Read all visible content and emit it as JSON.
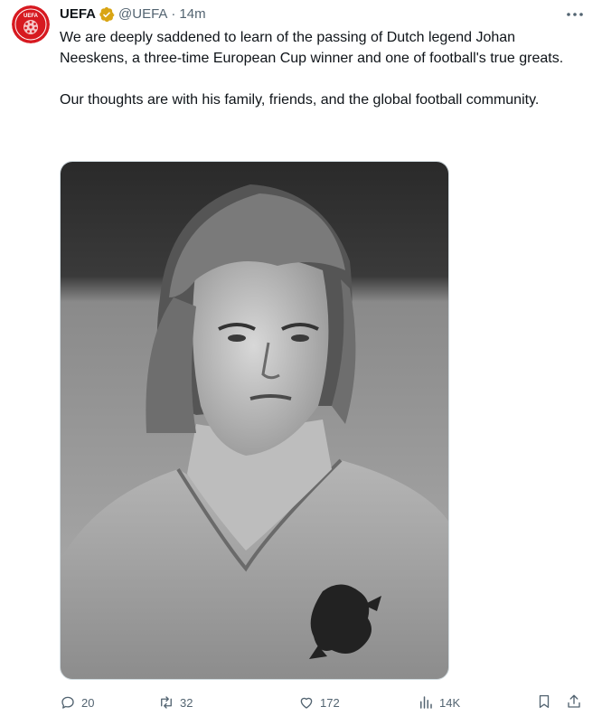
{
  "author": {
    "name": "UEFA",
    "handle": "@UEFA",
    "separator": "·",
    "timestamp": "14m",
    "avatar_text": "UEFA",
    "verified_badge_color": "#d9a514",
    "avatar_color": "#d71920"
  },
  "tweet": {
    "paragraph_1": "We are deeply saddened to learn of the passing of Dutch legend Johan Neeskens, a three-time European Cup winner and one of football's true greats.",
    "paragraph_2": "Our thoughts are with his family, friends, and the global football community."
  },
  "media": {
    "type": "black-and-white photo"
  },
  "actions": {
    "replies": "20",
    "reposts": "32",
    "likes": "172",
    "views": "14K"
  },
  "icons": {
    "more": "more-horizontal-icon",
    "reply": "reply-icon",
    "repost": "repost-icon",
    "like": "heart-icon",
    "views": "views-icon",
    "bookmark": "bookmark-icon",
    "share": "share-icon"
  }
}
